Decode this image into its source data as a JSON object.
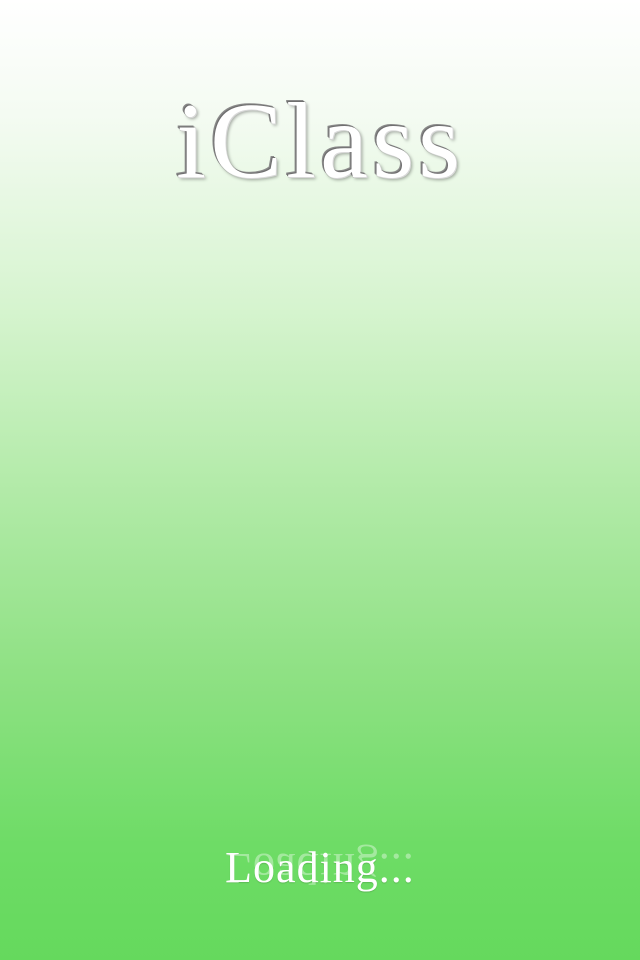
{
  "app": {
    "title": "iClass"
  },
  "status": {
    "loading": "Loading..."
  },
  "colors": {
    "top_background": "#ffffff",
    "bottom_background": "#65d95d",
    "loading_text": "#ffffff"
  }
}
